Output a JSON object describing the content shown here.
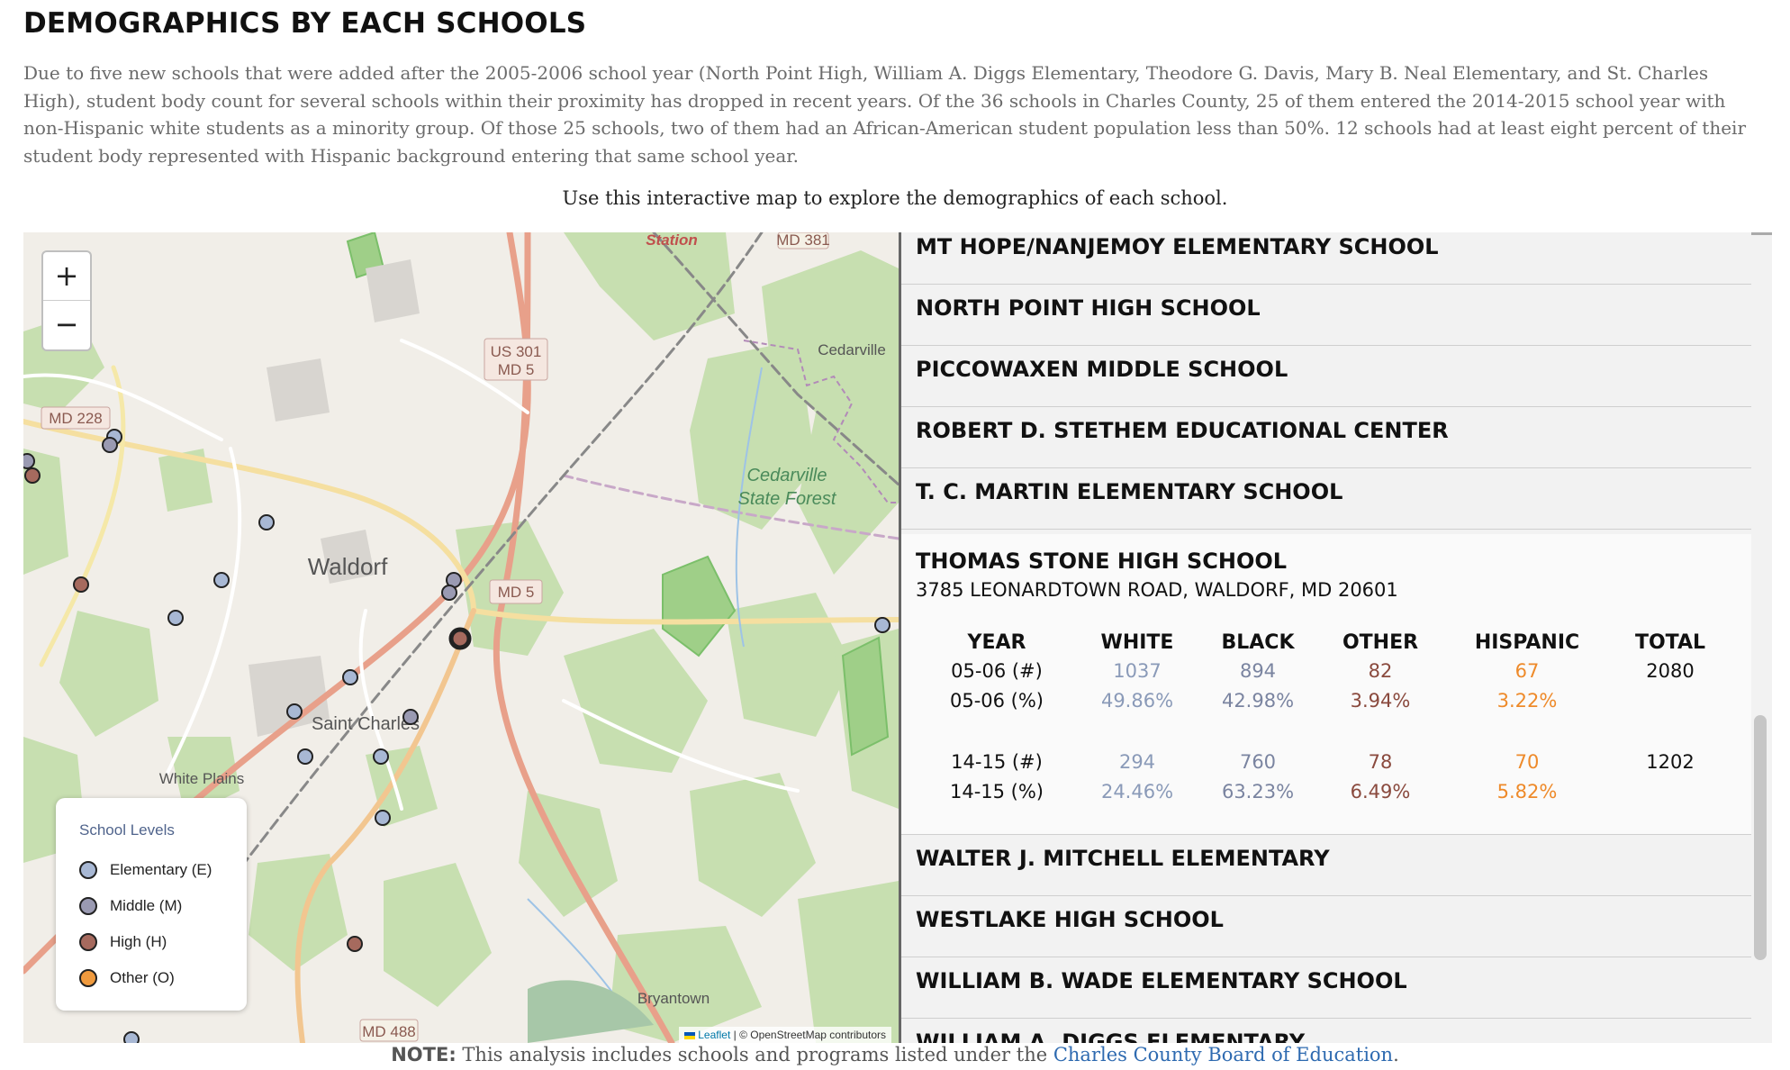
{
  "page": {
    "title": "DEMOGRAPHICS BY EACH SCHOOLS",
    "intro": "Due to five new schools that were added after the 2005-2006 school year (North Point High, William A. Diggs Elementary, Theodore G. Davis, Mary B. Neal Elementary, and St. Charles High), student body count for several schools within their proximity has dropped in recent years. Of the 36 schools in Charles County, 25 of them entered the 2014-2015 school year with non-Hispanic white students as a minority group. Of those 25 schools, two of them had an African-American student population less than 50%. 12 schools had at least eight percent of their student body represented with Hispanic background entering that same school year.",
    "map_caption": "Use this interactive map to explore the demographics of each school."
  },
  "map": {
    "zoom_in": "+",
    "zoom_out": "−",
    "place_labels": [
      "Station",
      "MD 381",
      "Cedarville",
      "US 301",
      "MD 5",
      "MD 228",
      "Cedarville",
      "State Forest",
      "Waldorf",
      "MD 5",
      "Saint Charles",
      "White Plains",
      "Bryantown",
      "MD 488"
    ],
    "legend": {
      "title": "School Levels",
      "items": [
        {
          "label": "Elementary (E)",
          "color": "#a8b8d4"
        },
        {
          "label": "Middle (M)",
          "color": "#9a9ab2"
        },
        {
          "label": "High (H)",
          "color": "#a66a5e"
        },
        {
          "label": "Other (O)",
          "color": "#ef9a3e"
        }
      ]
    },
    "attribution_leaflet": "Leaflet",
    "attribution_rest": "| © OpenStreetMap contributors"
  },
  "schools": {
    "collapsed_before": [
      "MT HOPE/NANJEMOY ELEMENTARY SCHOOL",
      "NORTH POINT HIGH SCHOOL",
      "PICCOWAXEN MIDDLE SCHOOL",
      "ROBERT D. STETHEM EDUCATIONAL CENTER",
      "T. C. MARTIN ELEMENTARY SCHOOL"
    ],
    "selected": {
      "name": "THOMAS STONE HIGH SCHOOL",
      "address": "3785 LEONARDTOWN ROAD, WALDORF, MD 20601",
      "headers": [
        "YEAR",
        "WHITE",
        "BLACK",
        "OTHER",
        "HISPANIC",
        "TOTAL"
      ],
      "rows": [
        [
          "05-06 (#)",
          "1037",
          "894",
          "82",
          "67",
          "2080"
        ],
        [
          "05-06 (%)",
          "49.86%",
          "42.98%",
          "3.94%",
          "3.22%",
          ""
        ],
        [
          "14-15 (#)",
          "294",
          "760",
          "78",
          "70",
          "1202"
        ],
        [
          "14-15 (%)",
          "24.46%",
          "63.23%",
          "6.49%",
          "5.82%",
          ""
        ]
      ],
      "column_colors": [
        "#111111",
        "#8a9ab8",
        "#7a84a0",
        "#8a4a3e",
        "#ee8a2a",
        "#111111"
      ]
    },
    "collapsed_after": [
      "WALTER J. MITCHELL ELEMENTARY",
      "WESTLAKE HIGH SCHOOL",
      "WILLIAM B. WADE ELEMENTARY SCHOOL",
      "WILLIAM A. DIGGS ELEMENTARY"
    ]
  },
  "note": {
    "prefix": "NOTE:",
    "text": " This analysis includes schools and programs listed under the ",
    "link": "Charles County Board of Education",
    "suffix": "."
  }
}
